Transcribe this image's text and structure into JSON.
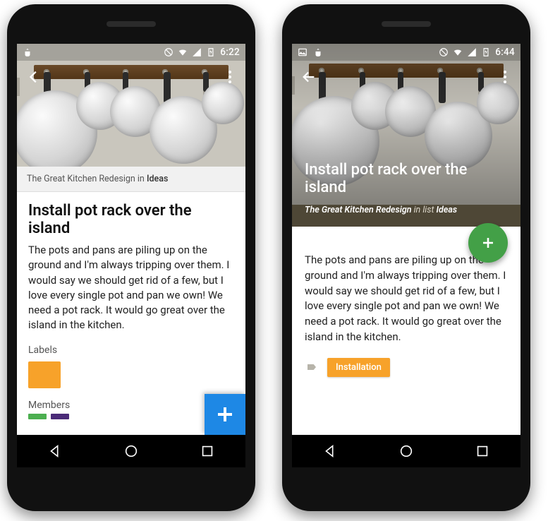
{
  "phoneA": {
    "status": {
      "time": "6:22"
    },
    "breadcrumb": {
      "board": "The Great Kitchen Redesign",
      "connector": " in ",
      "list": "Ideas"
    },
    "title": "Install pot rack over the island",
    "description": "The pots and pans are piling up on the ground and I'm always tripping over them. I would say we should get rid of a few, but I love every single pot and pan we own! We need a pot rack. It would go great over the island in the kitchen.",
    "sections": {
      "labels": "Labels",
      "members": "Members"
    },
    "labels": [
      {
        "color": "#f7a22a"
      }
    ],
    "fab": {
      "action": "add"
    }
  },
  "phoneB": {
    "status": {
      "time": "6:44"
    },
    "title": "Install pot rack over the island",
    "breadcrumb": {
      "board": "The Great Kitchen Redesign",
      "connector": " in list ",
      "list": "Ideas"
    },
    "description": "The pots and pans are piling up on the ground and I'm always tripping over them. I would say we should get rid of a few, but I love every single pot and pan we own! We need a pot rack. It would go great over the island in the kitchen.",
    "labels": [
      {
        "name": "Installation",
        "color": "#f7a22a"
      }
    ],
    "fab": {
      "action": "add"
    }
  }
}
